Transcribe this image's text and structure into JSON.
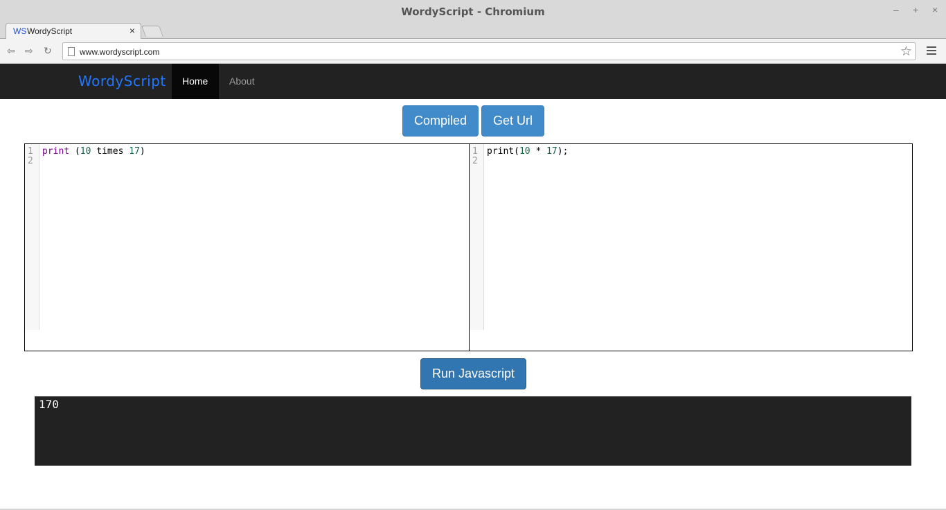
{
  "window": {
    "title": "WordyScript - Chromium",
    "minimize": "–",
    "maximize": "+",
    "close": "×"
  },
  "browser": {
    "tab": {
      "favicon": "WS",
      "title": "WordyScript",
      "close": "×"
    },
    "back_icon": "⇦",
    "forward_icon": "⇨",
    "reload_icon": "↻",
    "url": "www.wordyscript.com",
    "star_icon": "☆"
  },
  "site": {
    "brand": "WordyScript",
    "nav": [
      {
        "label": "Home",
        "active": true
      },
      {
        "label": "About",
        "active": false
      }
    ]
  },
  "actions": {
    "compiled_label": "Compiled",
    "get_url_label": "Get Url",
    "run_label": "Run Javascript"
  },
  "editors": {
    "source": {
      "line_numbers": [
        "1",
        "2"
      ],
      "tokens": [
        {
          "text": "print",
          "kind": "keyword"
        },
        {
          "text": " (",
          "kind": "plain"
        },
        {
          "text": "10",
          "kind": "number"
        },
        {
          "text": " times ",
          "kind": "plain"
        },
        {
          "text": "17",
          "kind": "number"
        },
        {
          "text": ")",
          "kind": "plain"
        }
      ]
    },
    "compiled": {
      "line_numbers": [
        "1",
        "2"
      ],
      "tokens": [
        {
          "text": "print(",
          "kind": "plain"
        },
        {
          "text": "10",
          "kind": "number"
        },
        {
          "text": " * ",
          "kind": "plain"
        },
        {
          "text": "17",
          "kind": "number"
        },
        {
          "text": ");",
          "kind": "plain"
        }
      ]
    }
  },
  "output": {
    "text": "170"
  },
  "colors": {
    "brand": "#2277ff",
    "button": "#428bca",
    "navbar": "#222222",
    "output_bg": "#222222",
    "keyword": "#770088",
    "number": "#116644"
  }
}
